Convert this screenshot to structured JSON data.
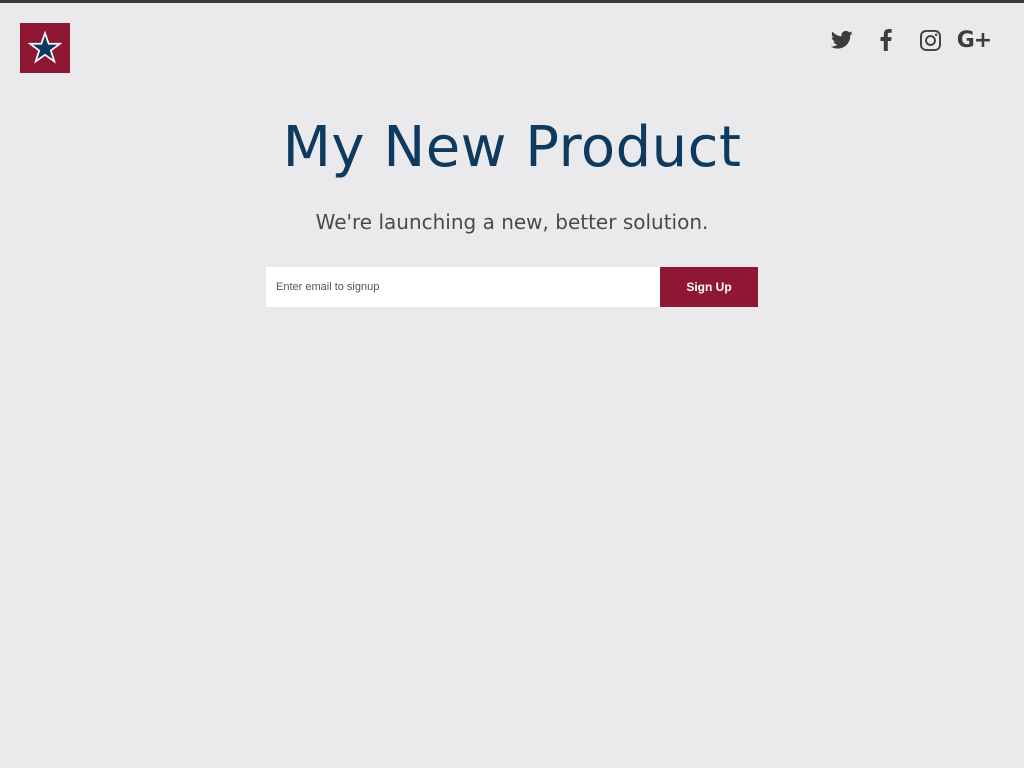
{
  "header": {
    "logo_icon": "star-icon",
    "colors": {
      "brand": "#8e1734",
      "star": "#0f3a5f",
      "star_outline": "#ffffff"
    },
    "social": [
      {
        "name": "twitter-icon"
      },
      {
        "name": "facebook-icon"
      },
      {
        "name": "instagram-icon"
      },
      {
        "name": "google-plus-icon",
        "glyph": "G+"
      }
    ]
  },
  "hero": {
    "title": "My New Product",
    "tagline": "We're launching a new, better solution.",
    "title_color": "#0f3a5f"
  },
  "signup": {
    "placeholder": "Enter email to signup",
    "value": "",
    "button_label": "Sign Up",
    "button_color": "#8e1734"
  }
}
